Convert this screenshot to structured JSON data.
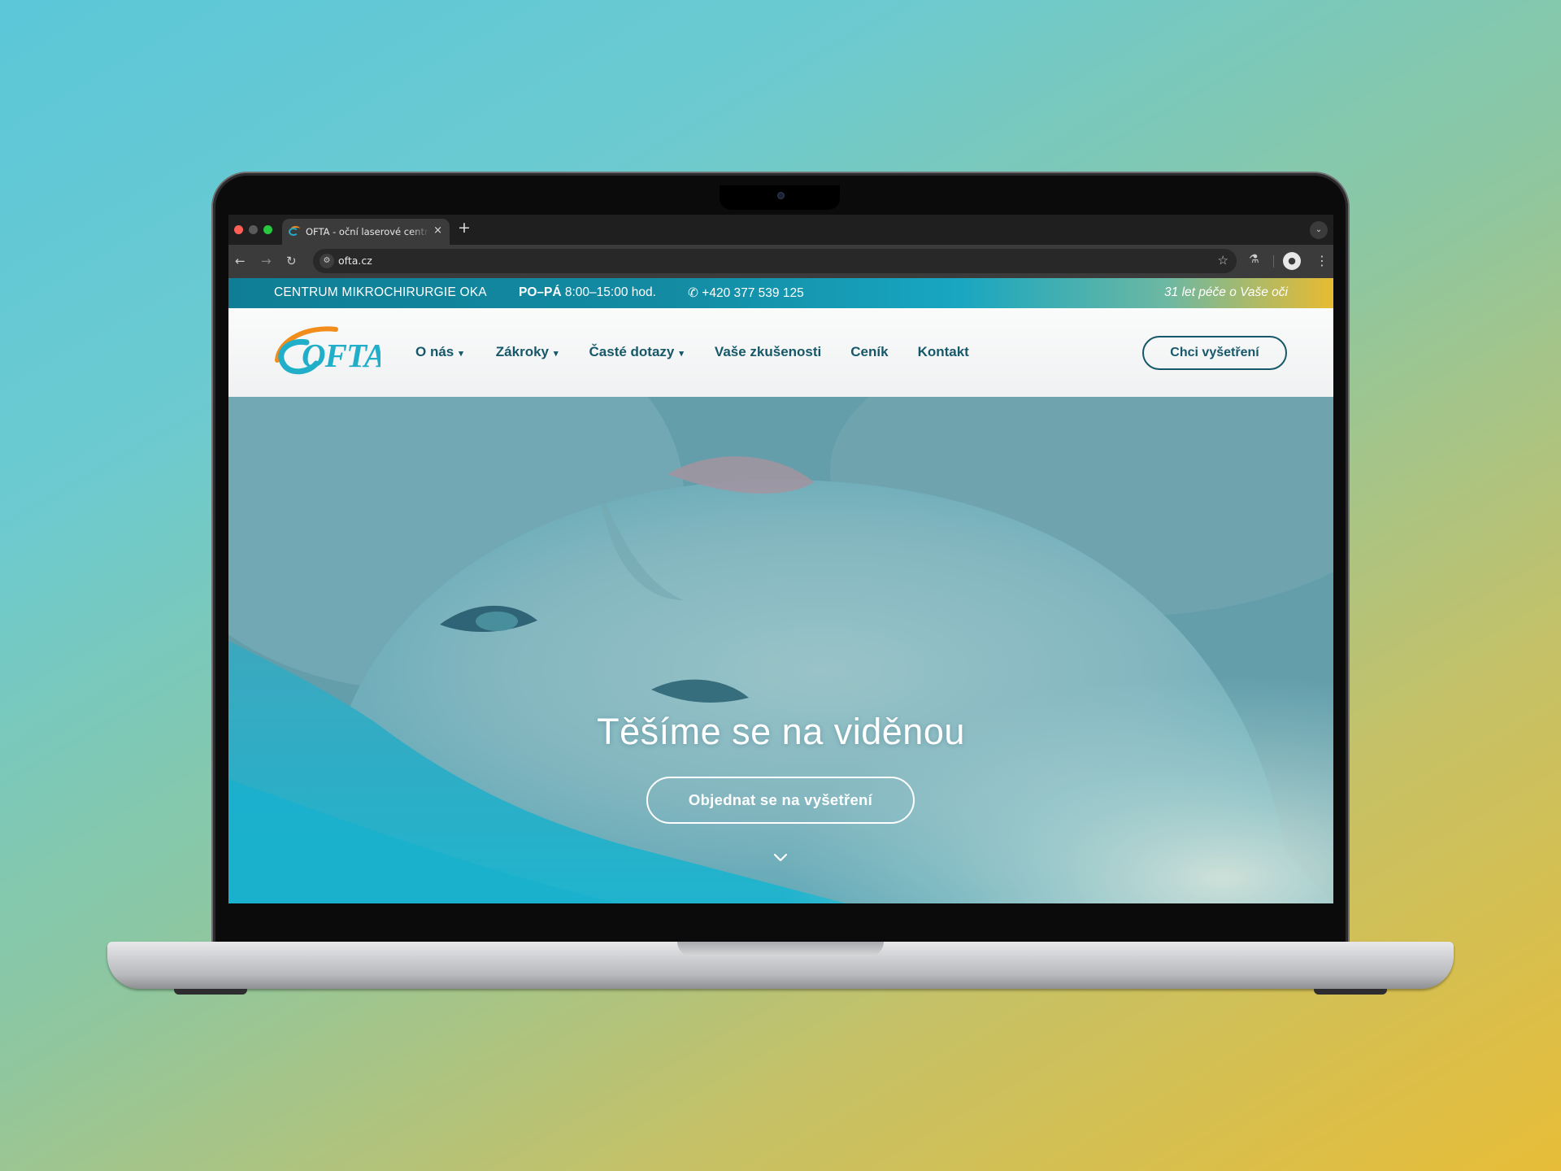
{
  "colors": {
    "brand_dark": "#16586a",
    "brand_teal": "#21aec8",
    "brand_orange": "#f28c1a",
    "topbar_gold": "#e8bb32"
  },
  "browser": {
    "tab_title": "OFTA - oční laserové centrum",
    "tab_close": "×",
    "new_tab": "+",
    "url": "ofta.cz",
    "icons": [
      "back-arrow-icon",
      "forward-arrow-icon",
      "reload-icon",
      "site-info-icon",
      "bookmark-star-icon",
      "labs-flask-icon",
      "profile-icon",
      "menu-kebab-icon"
    ]
  },
  "topbar": {
    "center_name": "CENTRUM MIKROCHIRURGIE OKA",
    "hours_days": "PO–PÁ",
    "hours_time": " 8:00–15:00 hod.",
    "phone": "+420 377 539 125",
    "slogan": "31 let péče o Vaše oči"
  },
  "header": {
    "logo_text": "OFTA",
    "nav": [
      {
        "label": "O nás",
        "has_dropdown": true
      },
      {
        "label": "Zákroky",
        "has_dropdown": true
      },
      {
        "label": "Časté dotazy",
        "has_dropdown": true
      },
      {
        "label": "Vaše zkušenosti",
        "has_dropdown": false
      },
      {
        "label": "Ceník",
        "has_dropdown": false
      },
      {
        "label": "Kontakt",
        "has_dropdown": false
      }
    ],
    "cta": "Chci vyšetření"
  },
  "hero": {
    "title": "Těšíme se na viděnou",
    "cta": "Objednat se na vyšetření"
  }
}
